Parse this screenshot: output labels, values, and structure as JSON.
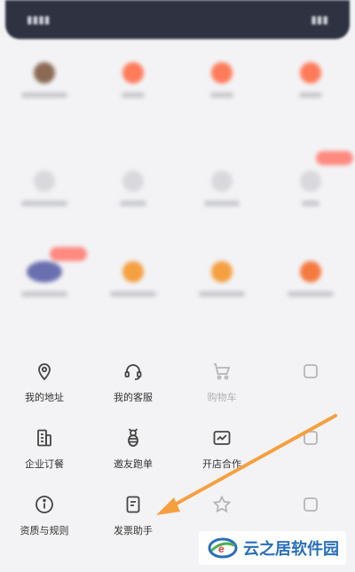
{
  "colors": {
    "accent_orange": "#f5a040",
    "text": "#333333",
    "icon": "#444444",
    "watermark_blue": "#2a6fb8"
  },
  "menu": [
    [
      {
        "name": "address",
        "icon": "location-pin-icon",
        "label": "我的地址",
        "faded": false
      },
      {
        "name": "customer-service",
        "icon": "headset-icon",
        "label": "我的客服",
        "faded": false
      },
      {
        "name": "cart",
        "icon": "shopping-cart-icon",
        "label": "购物车",
        "faded": true
      },
      {
        "name": "placeholder-1",
        "icon": "generic-icon",
        "label": "",
        "faded": true
      }
    ],
    [
      {
        "name": "corporate-order",
        "icon": "corporate-order-icon",
        "label": "企业订餐",
        "faded": false
      },
      {
        "name": "friend-delivery",
        "icon": "bee-runner-icon",
        "label": "邀友跑单",
        "faded": false
      },
      {
        "name": "open-store",
        "icon": "store-cooperation-icon",
        "label": "开店合作",
        "faded": false
      },
      {
        "name": "placeholder-2",
        "icon": "generic-icon",
        "label": "",
        "faded": true
      }
    ],
    [
      {
        "name": "qualifications-rules",
        "icon": "info-circle-icon",
        "label": "资质与规则",
        "faded": false
      },
      {
        "name": "invoice-assistant",
        "icon": "invoice-icon",
        "label": "发票助手",
        "faded": false
      },
      {
        "name": "favorites",
        "icon": "star-icon",
        "label": "",
        "faded": true
      },
      {
        "name": "placeholder-3",
        "icon": "generic-icon",
        "label": "",
        "faded": true
      }
    ]
  ],
  "watermark": {
    "text": "云之居软件园"
  }
}
